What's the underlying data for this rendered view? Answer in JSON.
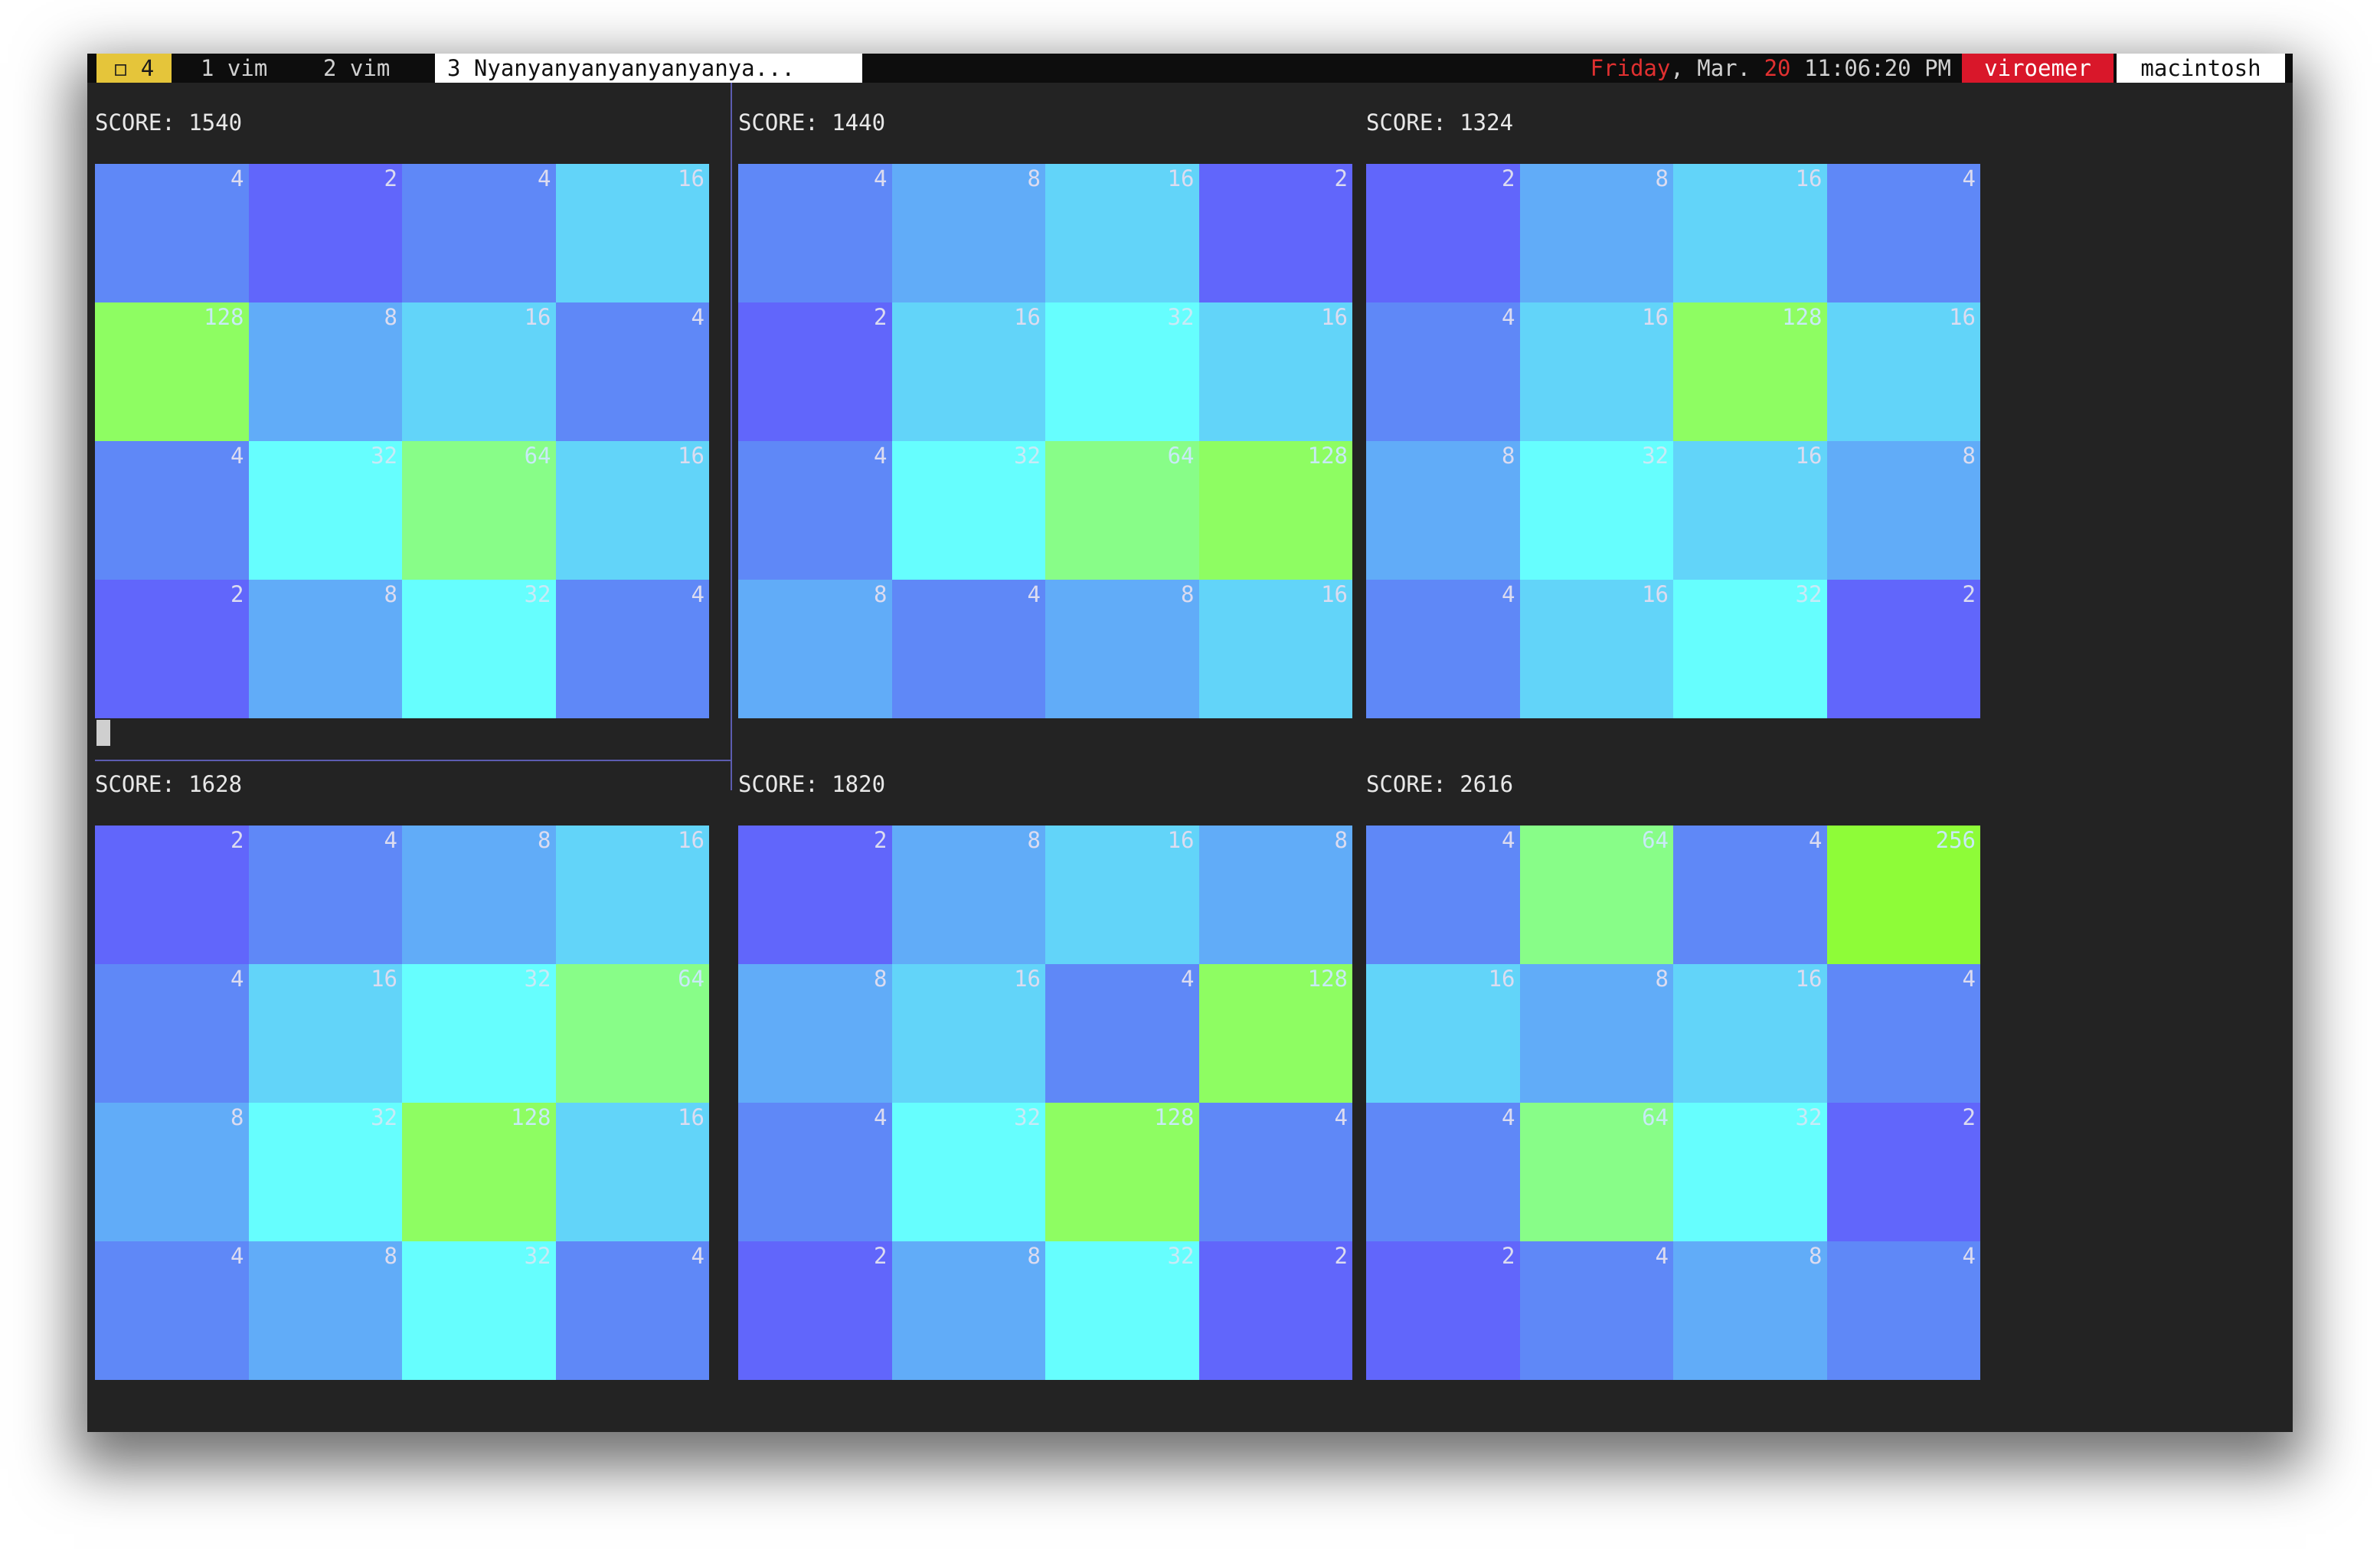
{
  "statusbar": {
    "workspace": "◻ 4",
    "windows": [
      "1 vim",
      "2 vim",
      "3 Nyanyanyanyanyanyanya..."
    ],
    "clock": {
      "day": "Friday",
      "sep": ", Mar. ",
      "date": "20",
      "time": " 11:06:20 PM"
    },
    "user": "viroemer",
    "host": "macintosh"
  },
  "score_prefix": "SCORE: ",
  "tile_colors": {
    "2": "#6166fb",
    "4": "#5f88f7",
    "8": "#61acf8",
    "16": "#62d4f9",
    "32": "#66fefe",
    "64": "#88fd88",
    "128": "#8efd62",
    "256": "#8efc38"
  },
  "boards": [
    {
      "score": "1540",
      "tiles": [
        "4",
        "2",
        "4",
        "16",
        "128",
        "8",
        "16",
        "4",
        "4",
        "32",
        "64",
        "16",
        "2",
        "8",
        "32",
        "4"
      ]
    },
    {
      "score": "1440",
      "tiles": [
        "4",
        "8",
        "16",
        "2",
        "2",
        "16",
        "32",
        "16",
        "4",
        "32",
        "64",
        "128",
        "8",
        "4",
        "8",
        "16"
      ]
    },
    {
      "score": "1324",
      "tiles": [
        "2",
        "8",
        "16",
        "4",
        "4",
        "16",
        "128",
        "16",
        "8",
        "32",
        "16",
        "8",
        "4",
        "16",
        "32",
        "2"
      ]
    },
    {
      "score": "1628",
      "tiles": [
        "2",
        "4",
        "8",
        "16",
        "4",
        "16",
        "32",
        "64",
        "8",
        "32",
        "128",
        "16",
        "4",
        "8",
        "32",
        "4"
      ]
    },
    {
      "score": "1820",
      "tiles": [
        "2",
        "8",
        "16",
        "8",
        "8",
        "16",
        "4",
        "128",
        "4",
        "32",
        "128",
        "4",
        "2",
        "8",
        "32",
        "2"
      ]
    },
    {
      "score": "2616",
      "tiles": [
        "4",
        "64",
        "4",
        "256",
        "16",
        "8",
        "16",
        "4",
        "4",
        "64",
        "32",
        "2",
        "2",
        "4",
        "8",
        "4"
      ]
    }
  ]
}
